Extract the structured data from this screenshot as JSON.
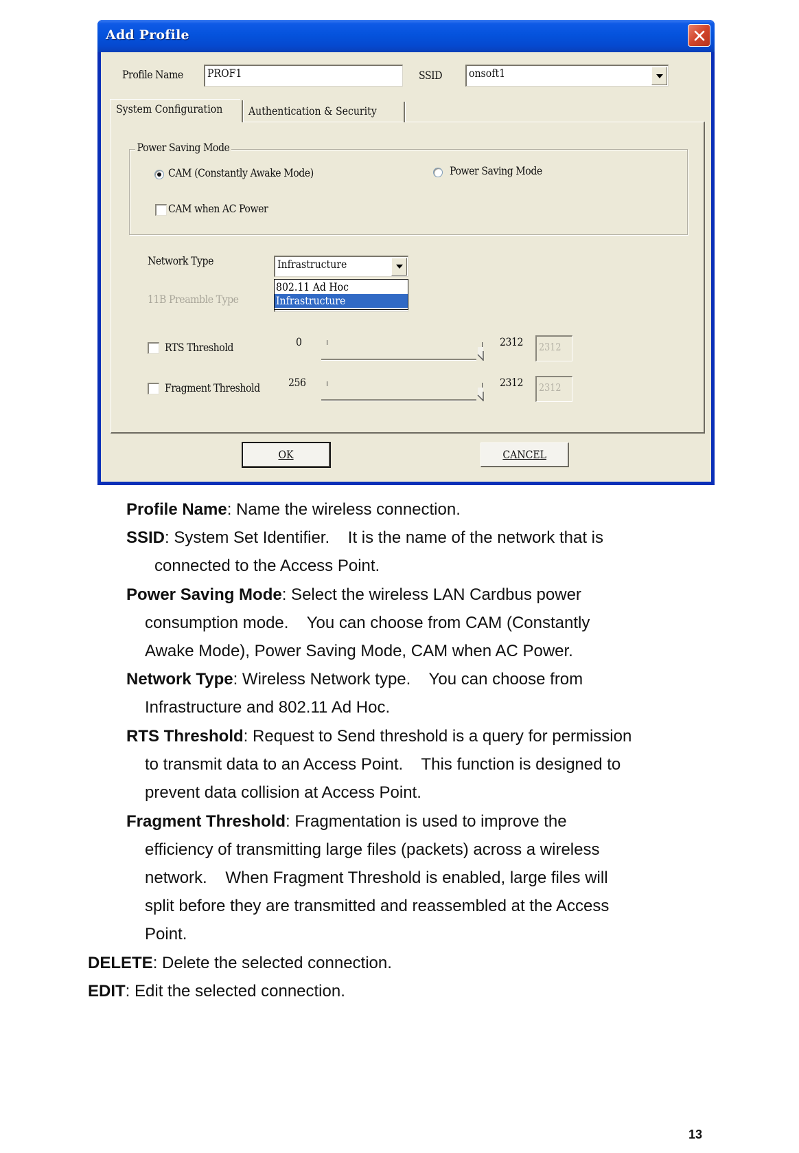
{
  "dialog": {
    "title": "Add Profile",
    "profile_name_label": "Profile Name",
    "profile_name_value": "PROF1",
    "ssid_label": "SSID",
    "ssid_value": "onsoft1",
    "tabs": [
      {
        "label": "System Configuration",
        "active": true
      },
      {
        "label": "Authentication & Security",
        "active": false
      }
    ],
    "power_saving_group": {
      "title": "Power Saving Mode",
      "options": [
        {
          "label": "CAM (Constantly Awake Mode)",
          "type": "radio",
          "checked": true
        },
        {
          "label": "Power Saving Mode",
          "type": "radio",
          "checked": false
        },
        {
          "label": "CAM when AC Power",
          "type": "checkbox",
          "checked": false
        }
      ]
    },
    "network_type": {
      "label": "Network Type",
      "value": "Infrastructure",
      "options": [
        "802.11 Ad Hoc",
        "Infrastructure"
      ],
      "highlighted": "Infrastructure"
    },
    "preamble_type": {
      "label": "11B Preamble Type",
      "enabled": false
    },
    "rts_threshold": {
      "label": "RTS Threshold",
      "checked": false,
      "min": "0",
      "max": "2312",
      "value": "2312"
    },
    "fragment_threshold": {
      "label": "Fragment Threshold",
      "checked": false,
      "min": "256",
      "max": "2312",
      "value": "2312"
    },
    "buttons": {
      "ok": "OK",
      "cancel": "CANCEL"
    }
  },
  "doc": {
    "items": [
      {
        "term": "Profile Name",
        "lines": [
          ": Name the wireless connection."
        ]
      },
      {
        "term": "SSID",
        "lines": [
          ": System Set Identifier.    It is the name of the network that is",
          "connected to the Access Point."
        ]
      },
      {
        "term": "Power Saving Mode",
        "lines": [
          ": Select the wireless LAN Cardbus power",
          "consumption mode.    You can choose from CAM (Constantly",
          "Awake Mode), Power Saving Mode, CAM when AC Power."
        ]
      },
      {
        "term": "Network Type",
        "lines": [
          ": Wireless Network type.    You can choose from",
          "Infrastructure and 802.11 Ad Hoc."
        ]
      },
      {
        "term": "RTS Threshold",
        "lines": [
          ": Request to Send threshold is a query for permission",
          "to transmit data to an Access Point.    This function is designed to",
          "prevent data collision at Access Point."
        ]
      },
      {
        "term": "Fragment Threshold",
        "lines": [
          ": Fragmentation is used to improve the",
          "efficiency of transmitting large files (packets) across a wireless",
          "network.    When Fragment Threshold is enabled, large files will",
          "split before they are transmitted and reassembled at the Access",
          "Point."
        ]
      },
      {
        "term": "DELETE",
        "lines": [
          ": Delete the selected connection."
        ]
      },
      {
        "term": "EDIT",
        "lines": [
          ": Edit the selected connection."
        ]
      }
    ],
    "page_number": "13"
  }
}
